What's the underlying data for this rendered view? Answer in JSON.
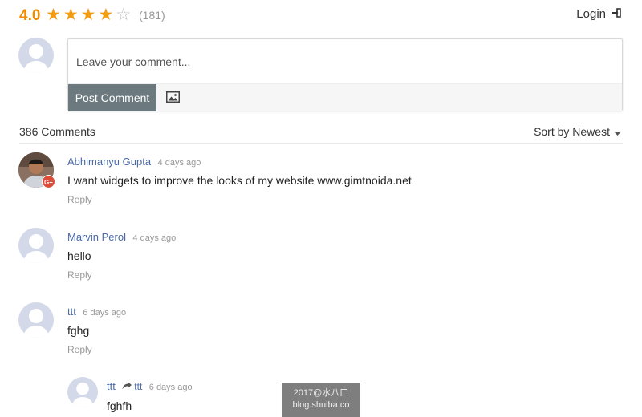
{
  "rating": {
    "value": "4.0",
    "stars": 4,
    "max_stars": 5,
    "count": "(181)"
  },
  "header": {
    "login_label": "Login"
  },
  "composer": {
    "placeholder": "Leave your comment...",
    "post_label": "Post Comment"
  },
  "comments_bar": {
    "count_label": "386 Comments",
    "sort_label": "Sort by Newest"
  },
  "comments": [
    {
      "author": "Abhimanyu Gupta",
      "time": "4 days ago",
      "text": "I want widgets to improve the looks of my website www.gimtnoida.net",
      "reply": "Reply"
    },
    {
      "author": "Marvin Perol",
      "time": "4 days ago",
      "text": "hello",
      "reply": "Reply"
    },
    {
      "author": "ttt",
      "time": "6 days ago",
      "text": "fghg",
      "reply": "Reply"
    },
    {
      "author": "ttt",
      "reply_to": "ttt",
      "time": "6 days ago",
      "text": "fghfh"
    }
  ],
  "watermark": {
    "line1": "2017@水八口",
    "line2": "blog.shuiba.co"
  },
  "colors": {
    "accent": "#f08c00",
    "author": "#4a69a8",
    "button": "#6c7a80",
    "gplus": "#dd4b39"
  }
}
